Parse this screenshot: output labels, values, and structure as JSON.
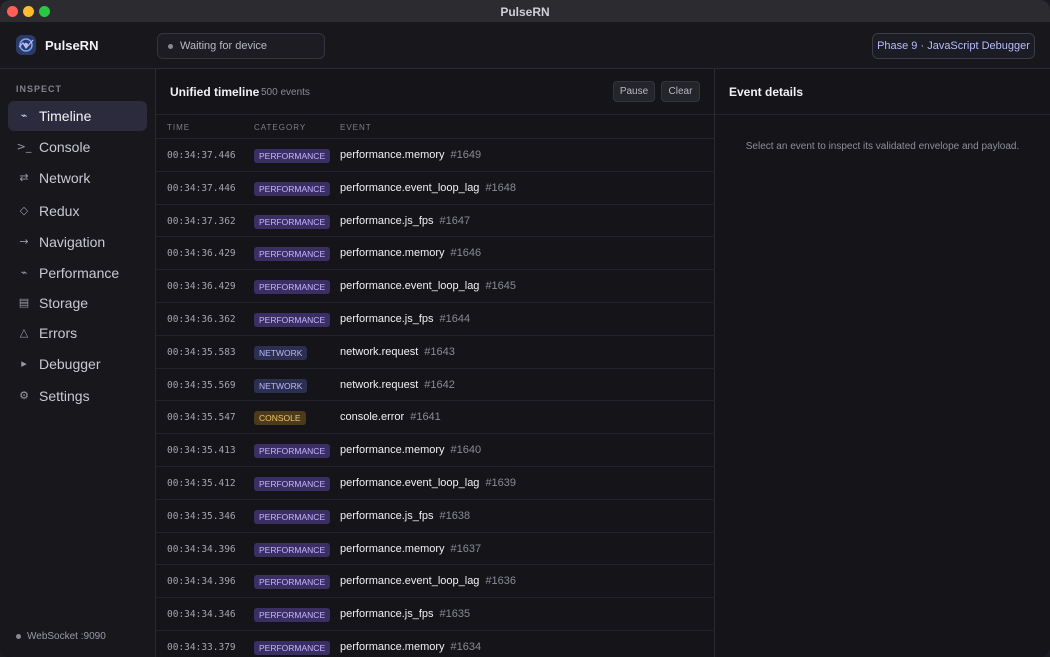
{
  "window": {
    "title": "PulseRN"
  },
  "header": {
    "app_name": "PulseRN",
    "device_status": "Waiting for device",
    "phase_button": "Phase 9 · JavaScript Debugger"
  },
  "sidebar": {
    "section_label": "INSPECT",
    "items": [
      {
        "label": "Timeline",
        "icon": "pulse-icon",
        "glyph": "⌁",
        "active": true
      },
      {
        "label": "Console",
        "icon": "terminal-icon",
        "glyph": ">_",
        "active": false
      },
      {
        "label": "Network",
        "icon": "arrows-icon",
        "glyph": "⇄",
        "active": false
      },
      {
        "label": "Redux",
        "icon": "diamond-icon",
        "glyph": "◇",
        "active": false
      },
      {
        "label": "Navigation",
        "icon": "arrow-right-icon",
        "glyph": "→",
        "active": false
      },
      {
        "label": "Performance",
        "icon": "pulse-icon",
        "glyph": "⌁",
        "active": false
      },
      {
        "label": "Storage",
        "icon": "storage-icon",
        "glyph": "▤",
        "active": false
      },
      {
        "label": "Errors",
        "icon": "warning-icon",
        "glyph": "△",
        "active": false
      },
      {
        "label": "Debugger",
        "icon": "play-icon",
        "glyph": "▸",
        "active": false
      },
      {
        "label": "Settings",
        "icon": "gear-icon",
        "glyph": "⚙",
        "active": false
      }
    ],
    "websocket": "WebSocket :9090"
  },
  "timeline": {
    "title": "Unified timeline",
    "count": "500 events",
    "pause_label": "Pause",
    "clear_label": "Clear",
    "columns": [
      "TIME",
      "CATEGORY",
      "EVENT"
    ],
    "rows": [
      {
        "time": "00:34:37.446",
        "category": "PERFORMANCE",
        "kind": "performance",
        "event": "performance.memory",
        "id": "#1649"
      },
      {
        "time": "00:34:37.446",
        "category": "PERFORMANCE",
        "kind": "performance",
        "event": "performance.event_loop_lag",
        "id": "#1648"
      },
      {
        "time": "00:34:37.362",
        "category": "PERFORMANCE",
        "kind": "performance",
        "event": "performance.js_fps",
        "id": "#1647"
      },
      {
        "time": "00:34:36.429",
        "category": "PERFORMANCE",
        "kind": "performance",
        "event": "performance.memory",
        "id": "#1646"
      },
      {
        "time": "00:34:36.429",
        "category": "PERFORMANCE",
        "kind": "performance",
        "event": "performance.event_loop_lag",
        "id": "#1645"
      },
      {
        "time": "00:34:36.362",
        "category": "PERFORMANCE",
        "kind": "performance",
        "event": "performance.js_fps",
        "id": "#1644"
      },
      {
        "time": "00:34:35.583",
        "category": "NETWORK",
        "kind": "network",
        "event": "network.request",
        "id": "#1643"
      },
      {
        "time": "00:34:35.569",
        "category": "NETWORK",
        "kind": "network",
        "event": "network.request",
        "id": "#1642"
      },
      {
        "time": "00:34:35.547",
        "category": "CONSOLE",
        "kind": "console",
        "event": "console.error",
        "id": "#1641"
      },
      {
        "time": "00:34:35.413",
        "category": "PERFORMANCE",
        "kind": "performance",
        "event": "performance.memory",
        "id": "#1640"
      },
      {
        "time": "00:34:35.412",
        "category": "PERFORMANCE",
        "kind": "performance",
        "event": "performance.event_loop_lag",
        "id": "#1639"
      },
      {
        "time": "00:34:35.346",
        "category": "PERFORMANCE",
        "kind": "performance",
        "event": "performance.js_fps",
        "id": "#1638"
      },
      {
        "time": "00:34:34.396",
        "category": "PERFORMANCE",
        "kind": "performance",
        "event": "performance.memory",
        "id": "#1637"
      },
      {
        "time": "00:34:34.396",
        "category": "PERFORMANCE",
        "kind": "performance",
        "event": "performance.event_loop_lag",
        "id": "#1636"
      },
      {
        "time": "00:34:34.346",
        "category": "PERFORMANCE",
        "kind": "performance",
        "event": "performance.js_fps",
        "id": "#1635"
      },
      {
        "time": "00:34:33.379",
        "category": "PERFORMANCE",
        "kind": "performance",
        "event": "performance.memory",
        "id": "#1634"
      }
    ]
  },
  "details": {
    "title": "Event details",
    "empty_message": "Select an event to inspect its validated envelope and payload."
  },
  "colors": {
    "accent": "#2b2b3d",
    "performance_badge": "#3a2f63",
    "network_badge": "#2d2f52",
    "console_badge": "#4c3b1b"
  }
}
